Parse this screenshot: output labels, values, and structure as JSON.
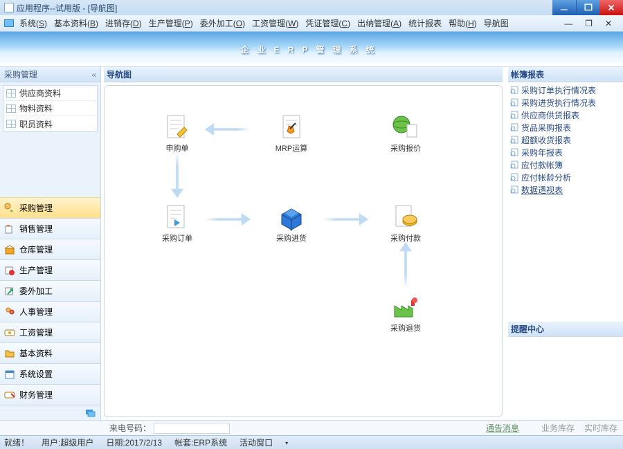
{
  "titlebar": {
    "text": "应用程序--试用版 - [导航图]"
  },
  "menubar": {
    "items": [
      "系统(<u>S</u>)",
      "基本资料(<u>B</u>)",
      "进销存(<u>D</u>)",
      "生产管理(<u>P</u>)",
      "委外加工(<u>O</u>)",
      "工资管理(<u>W</u>)",
      "凭证管理(<u>C</u>)",
      "出纳管理(<u>A</u>)",
      "统计报表",
      "帮助(<u>H</u>)",
      "导航图"
    ]
  },
  "banner": {
    "title": "企业ERP管理系统"
  },
  "sidebar": {
    "title": "采购管理",
    "quicklist": [
      "供应商资料",
      "物料资料",
      "职员资料"
    ],
    "nav": [
      {
        "label": "采购管理",
        "active": true
      },
      {
        "label": "销售管理",
        "active": false
      },
      {
        "label": "仓库管理",
        "active": false
      },
      {
        "label": "生产管理",
        "active": false
      },
      {
        "label": "委外加工",
        "active": false
      },
      {
        "label": "人事管理",
        "active": false
      },
      {
        "label": "工资管理",
        "active": false
      },
      {
        "label": "基本资料",
        "active": false
      },
      {
        "label": "系统设置",
        "active": false
      },
      {
        "label": "财务管理",
        "active": false
      }
    ]
  },
  "main": {
    "title": "导航图",
    "nodes": {
      "apply": "申购单",
      "mrp": "MRP运算",
      "quote": "采购报价",
      "order": "采购订单",
      "receive": "采购进货",
      "pay": "采购付款",
      "return": "采购退货"
    }
  },
  "rightpanel": {
    "reports_title": "帐簿报表",
    "reports": [
      "采购订单执行情况表",
      "采购进货执行情况表",
      "供应商供货报表",
      "货品采购报表",
      "超额收货报表",
      "采购年报表",
      "应付款帐簿",
      "应付帐龄分析",
      "数据透视表"
    ],
    "alerts_title": "提醒中心"
  },
  "callbar": {
    "label": "来电号码：",
    "link1": "通告消息",
    "link2": "业务库存",
    "link3": "实时库存"
  },
  "status": {
    "ready": "就绪！",
    "user": "用户:超级用户",
    "date": "日期:2017/2/13",
    "account": "帐套:ERP系统",
    "window": "活动窗口"
  }
}
